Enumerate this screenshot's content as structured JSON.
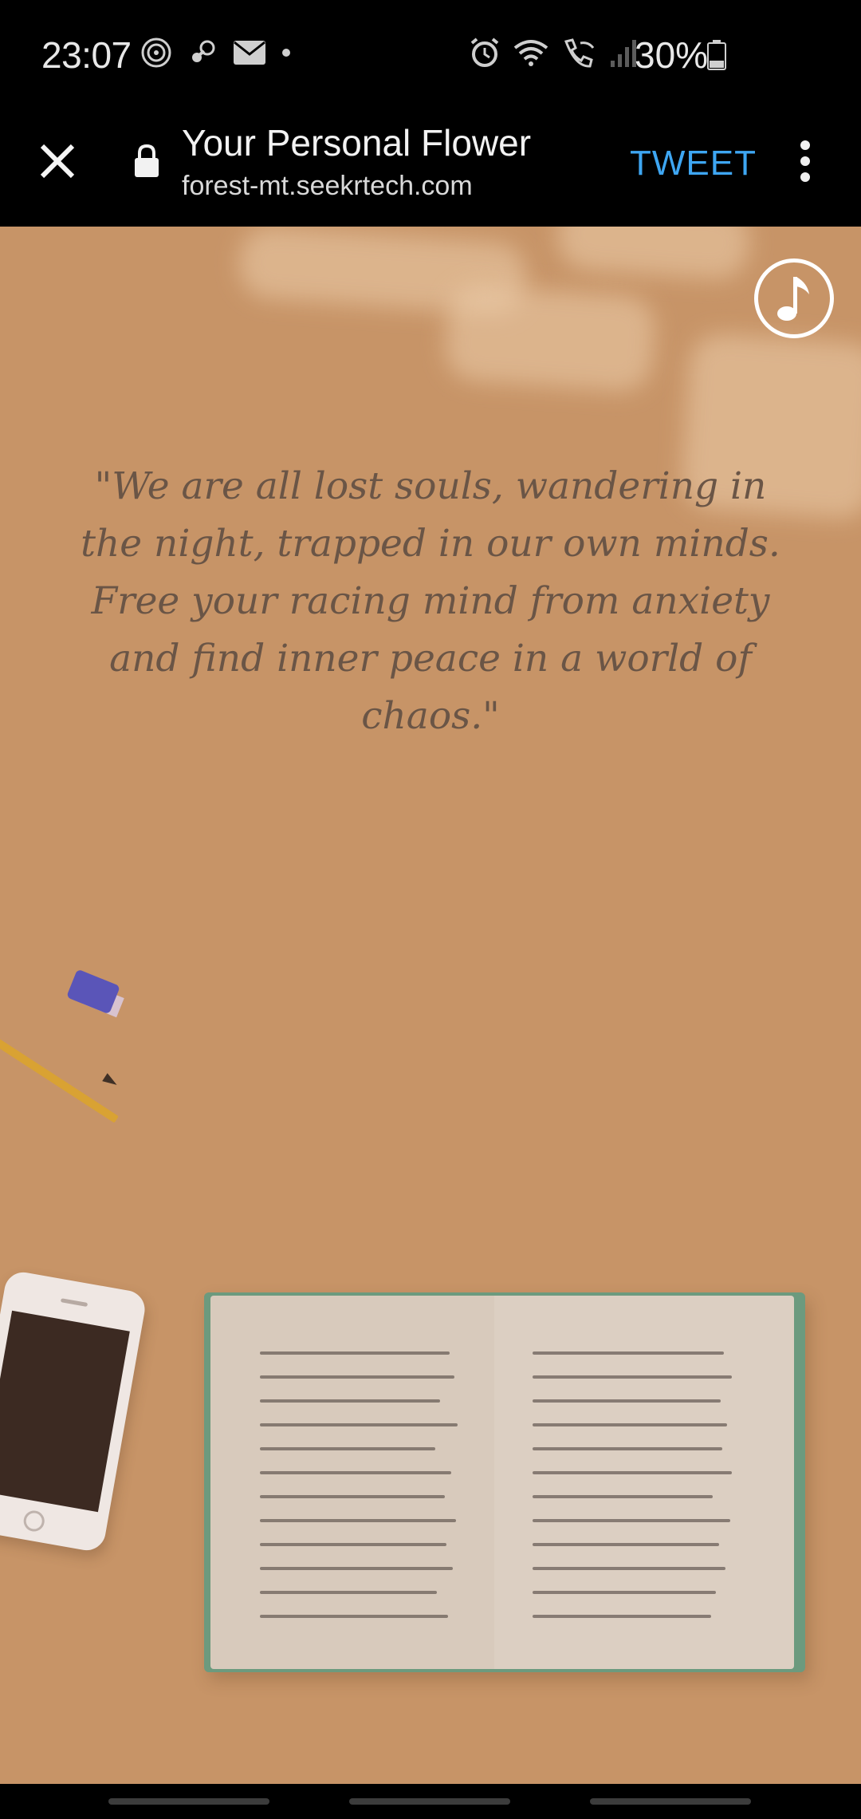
{
  "status_bar": {
    "time": "23:07",
    "battery": "30%",
    "left_icons": [
      "fingerprint-icon",
      "steam-icon",
      "mail-icon",
      "dot-icon"
    ],
    "right_icons": [
      "alarm-icon",
      "wifi-icon",
      "wifi-calling-icon",
      "signal-icon",
      "battery-icon"
    ]
  },
  "browser": {
    "title": "Your Personal Flower",
    "url": "forest-mt.seekrtech.com",
    "tweet_label": "TWEET",
    "icons": [
      "close-icon",
      "lock-icon",
      "more-vert-icon"
    ]
  },
  "page": {
    "quote": "\"We are all lost souls, wandering in the night, trapped in our own minds. Free your racing mind from anxiety and find inner peace in a world of chaos.\"",
    "music_icon": "music-note-icon"
  },
  "colors": {
    "background": "#c79467",
    "quote_text": "#6a5546",
    "tweet_accent": "#3ea6f2",
    "notebook_cover": "#6c9a7e"
  }
}
